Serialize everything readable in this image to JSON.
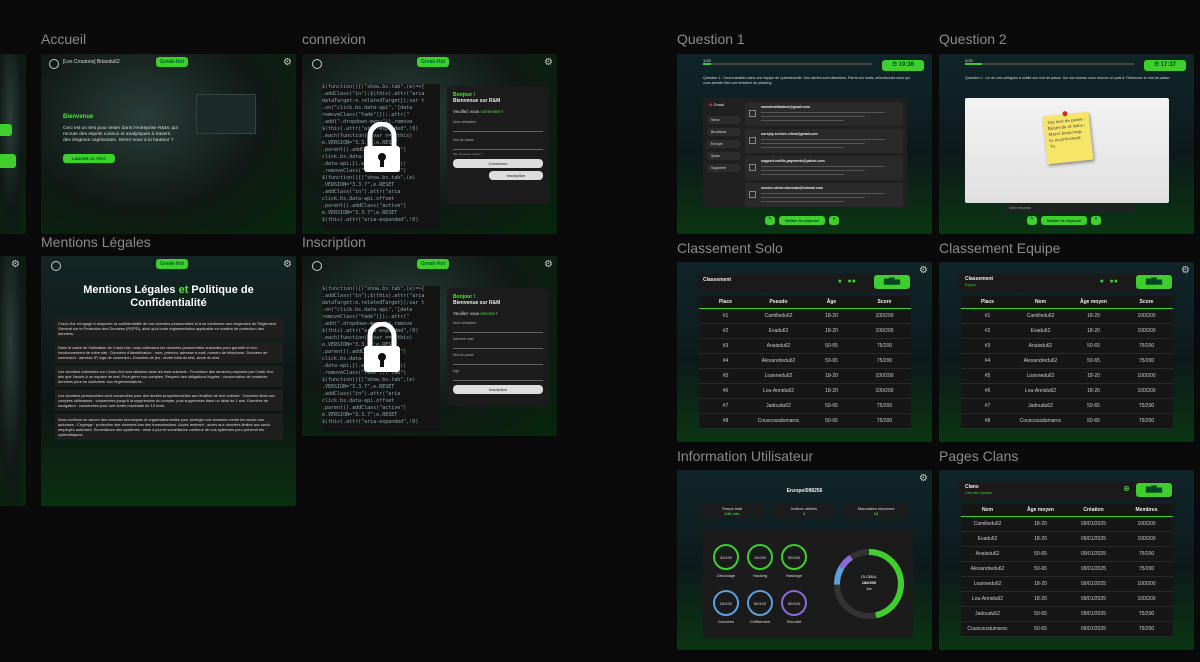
{
  "labels": {
    "accueil": "Accueil",
    "connexion": "connexion",
    "mentions": "Mentions Légales",
    "inscription": "Inscription",
    "q1": "Question 1",
    "q2": "Question 2",
    "solo": "Classement Solo",
    "equipe": "Classement Equipe",
    "info": "Information Utilisateur",
    "clans": "Pages Clans"
  },
  "brand": {
    "logo": "Greak-Hot"
  },
  "accueil": {
    "header": "[Les Croutons] Briandu62",
    "welcome": "Bienvenue",
    "text": "Ceci est un test pour tester dans l'entreprise R&M, qui recrute des esprits curieux et analytiques à travers des énigmes captivantes. Serez-vous à la hauteur ?",
    "cta": "LANCER LE TEST"
  },
  "connexion": {
    "hello": "Bonjour !",
    "welcome": "Bienvenue sur R&M",
    "prompt_a": "Veuillez vous ",
    "prompt_b": "connecter",
    "prompt_c": " !",
    "field1": "Nom utilisateur",
    "field2": "Mot de passe",
    "forgot": "Mot de passe oublié ?",
    "btn": "Connexion",
    "alt": "Inscription"
  },
  "inscription": {
    "hello": "Bonjour !",
    "welcome": "Bienvenue sur R&M",
    "prompt_a": "Veuillez vous ",
    "prompt_b": "inscrire",
    "prompt_c": " !",
    "f1": "Nom utilisateur",
    "f2": "Adresse mail",
    "f3": "Mot de passe",
    "f4": "Age",
    "btn": "Inscription"
  },
  "mentions": {
    "title_a": "Mentions Légales ",
    "title_b": "et",
    "title_c": " Politique de Confidentialité",
    "p1": "Crack-Hot s'engage à respecter la confidentialité de vos données personnelles et à se conformer aux exigences du Règlement Général sur la Protection des Données (RGPD), ainsi qu'à toute réglementation applicable en matière de protection des données.",
    "p2": "Dans le cadre de l'utilisation de Crack-Hot, nous collectons les données personnelles suivantes pour garantir le bon fonctionnement de notre site : Données d'identification : nom, prénom, adresse e-mail, numéro de téléphone. Données de connexion : adresse IP, logs de connexion. Données de jeu : durée total du test, score du test.",
    "p3": "Les données collectées sur Crack-Hot sont utilisées dans les buts suivants : Fourniture des services proposés par Crack-Hot, tels que l'accès à un espace de test. Pour gérer vos comptes. Respect des obligations légales : conservation de certaines données pour se conformer aux réglementations.",
    "p4": "Les données personnelles sont conservées pour des durées proportionnelles aux finalités de leur collecte : Données liées aux comptes utilisateurs : conservées jusqu'à la suppression du compte, puis supprimées dans un délai de 1 ans. Données de navigation : conservées pour une durée maximale de 13 mois.",
    "p5": "Nous mettons en œuvre des mesures techniques et organisationnelles pour protéger vos données contre les accès non autorisés : Cryptage : protection des données lors des transmissions. Accès restreint : accès aux données limités aux seuls employés autorisés. Surveillance des systèmes : mise à jour et surveillance continue de nos systèmes pour prévenir les cyberattaques."
  },
  "q1": {
    "num": "1/20",
    "timer": "19:36",
    "question": "Question 1 : Vous travaillez dans une équipe de cybersécurité. Des alertes sont détectées. Parmi ces mails, sélectionnez celui qui vous semble être une tentative de phishing.",
    "mail_title": "Gmail",
    "menu": [
      "Inbox",
      "Brouillons",
      "Envoyé",
      "Spam",
      "Supprimé"
    ],
    "mails": [
      "nomdeutilisateur@gmail.com",
      "noreply-service.client@gmail.com",
      "support-netflix.payments@yahoo.com",
      "service-client.ubereats@hotmail.com"
    ],
    "btn": "Valider ta réponse"
  },
  "q2": {
    "num": "2/20",
    "timer": "17:37",
    "question": "Question 2 : Un de vos collègues a oublié son mot de passe. Sur son bureau vous trouvez un post-it. Retrouvez le mot de passe.",
    "postit": "Ton mot de passe : Bénévole et Ados : Merci beaucoup, tu es prévenant. Tu",
    "btn": "Valider ta réponse",
    "input": "Votre réponse"
  },
  "solo": {
    "title": "Classement",
    "headers": [
      "Place",
      "Pseudo",
      "Âge",
      "Score"
    ],
    "rows": [
      [
        "#1",
        "Camilledu62",
        "18-20",
        "100/200"
      ],
      [
        "#2",
        "Evadu62",
        "18-20",
        "100/200"
      ],
      [
        "#3",
        "Anaisdu62",
        "50-65",
        "75/200"
      ],
      [
        "#4",
        "Alexandredu62",
        "50-65",
        "75/200"
      ],
      [
        "#5",
        "Loannedu62",
        "18-20",
        "100/200"
      ],
      [
        "#6",
        "Lou-Annidu62",
        "18-20",
        "100/200"
      ],
      [
        "#7",
        "Jadoudu62",
        "50-65",
        "75/200"
      ],
      [
        "#8",
        "Couscousdumaroc",
        "50-65",
        "75/200"
      ]
    ]
  },
  "equipe": {
    "title": "Classement",
    "sub": "Equipe",
    "headers": [
      "Place",
      "Nom",
      "Âge moyen",
      "Score"
    ],
    "rows": [
      [
        "#1",
        "Camilledu62",
        "18-20",
        "100/200"
      ],
      [
        "#2",
        "Evadu62",
        "18-20",
        "100/200"
      ],
      [
        "#3",
        "Anaisdu62",
        "50-65",
        "75/200"
      ],
      [
        "#4",
        "Alexandredu62",
        "50-65",
        "75/200"
      ],
      [
        "#5",
        "Loannedu62",
        "18-20",
        "100/200"
      ],
      [
        "#6",
        "Lou-Annidu62",
        "18-20",
        "100/200"
      ],
      [
        "#7",
        "Jadoudu62",
        "50-65",
        "75/200"
      ],
      [
        "#8",
        "Couscousdumaroc",
        "50-65",
        "75/200"
      ]
    ]
  },
  "info": {
    "user": "Enzopel098256",
    "stats": [
      {
        "label": "Temps total",
        "value": "140 min"
      },
      {
        "label": "Indices utilisés",
        "value": "4"
      },
      {
        "label": "Mauvaises réponses",
        "value": "13"
      }
    ],
    "circles": [
      {
        "v": "32/100",
        "l": "Décodage"
      },
      {
        "v": "15/200",
        "l": "Hacking"
      },
      {
        "v": "50/150",
        "l": "Hashage"
      },
      {
        "v": "25/100",
        "l": "Données"
      },
      {
        "v": "50/100",
        "l": "Chiffrement"
      },
      {
        "v": "50/100",
        "l": "Sécurité"
      }
    ],
    "global_a": "GLOBAL",
    "global_b": "186/300",
    "global_c": "1er"
  },
  "clans": {
    "title": "Clans",
    "sub": "Liste des équipes",
    "headers": [
      "Nom",
      "Âge moyen",
      "Création",
      "Membres"
    ],
    "rows": [
      [
        "Camilledu62",
        "18-20",
        "09/01/2025",
        "100/200"
      ],
      [
        "Evadu62",
        "18-20",
        "09/01/2025",
        "100/200"
      ],
      [
        "Anaisdu62",
        "50-65",
        "09/01/2025",
        "75/200"
      ],
      [
        "Alexandredu62",
        "50-65",
        "09/01/2025",
        "75/200"
      ],
      [
        "Loannedu62",
        "18-20",
        "09/01/2025",
        "100/200"
      ],
      [
        "Lou-Annidu62",
        "18-20",
        "09/01/2025",
        "100/200"
      ],
      [
        "Jadoudu62",
        "50-65",
        "09/01/2025",
        "75/200"
      ],
      [
        "Couscoustumaroc",
        "50-65",
        "09/01/2025",
        "75/200"
      ]
    ]
  }
}
